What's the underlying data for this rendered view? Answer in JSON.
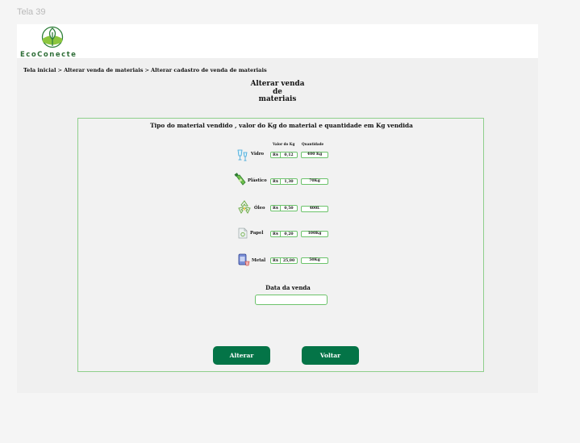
{
  "frame": {
    "label": "Tela 39"
  },
  "header": {
    "logo_text": "EcoConecte"
  },
  "breadcrumb": [
    "Tela inicial",
    ">",
    "Alterar  venda de materiais",
    ">",
    "Alterar cadastro de venda de materiais"
  ],
  "page_title": [
    "Alterar venda",
    "de",
    "materiais"
  ],
  "panel": {
    "heading": "Tipo do material vendido , valor do Kg do material e quantidade em Kg vendida",
    "col_value": "Valor do Kg",
    "col_qty": "Quantidade",
    "currency": "R$",
    "materials": [
      {
        "name": "Vidro",
        "value": "0,12",
        "qty": "400 Kg",
        "icon": "glass-icon"
      },
      {
        "name": "Plástico",
        "value": "1,30",
        "qty": "70Kg",
        "icon": "plastic-bottle-icon"
      },
      {
        "name": "Óleo",
        "value": "0,50",
        "qty": "400L",
        "icon": "recycle-oil-icon"
      },
      {
        "name": "Papel",
        "value": "0,20",
        "qty": "100Kg",
        "icon": "paper-icon"
      },
      {
        "name": "Metal",
        "value": "25,00",
        "qty": "50Kg",
        "icon": "metal-can-icon"
      }
    ]
  },
  "date": {
    "label": "Data  da venda",
    "value": ""
  },
  "buttons": {
    "alter": "Alterar",
    "back": "Voltar"
  },
  "colors": {
    "primary": "#047447",
    "border": "#6cc36b",
    "logo": "#2f6e38"
  }
}
